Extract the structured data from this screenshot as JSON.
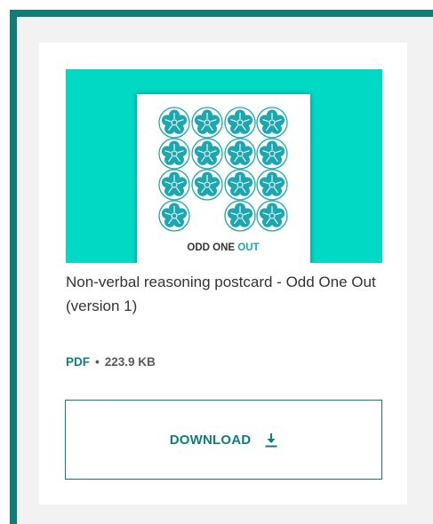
{
  "resource": {
    "title": "Non-verbal reasoning postcard - Odd One Out (version 1)",
    "file_type": "PDF",
    "separator": "•",
    "file_size": "223.9 KB",
    "download_label": "DOWNLOAD"
  },
  "thumbnail": {
    "caption_left": "ODD ONE ",
    "caption_highlight": "OUT",
    "background": "#02d9c5",
    "flower_color": "#1ba7b0"
  },
  "colors": {
    "accent": "#0e7e7b",
    "panel": "#f2f2f2"
  },
  "icons": {
    "download": "download-arrow-icon"
  }
}
